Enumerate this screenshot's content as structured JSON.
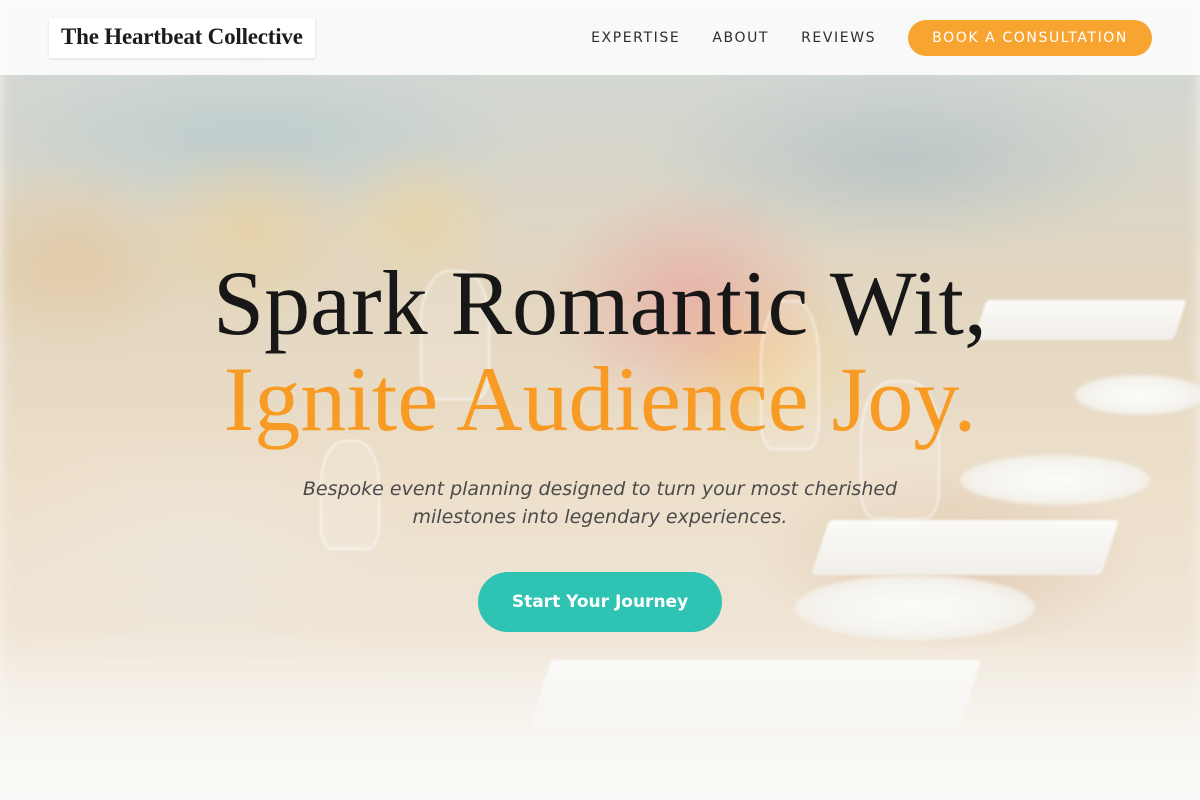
{
  "brand": {
    "name": "The Heartbeat Collective"
  },
  "nav": {
    "links": [
      "EXPERTISE",
      "ABOUT",
      "REVIEWS"
    ],
    "cta_label": "BOOK A CONSULTATION"
  },
  "hero": {
    "headline_line1": "Spark Romantic Wit,",
    "headline_line2": "Ignite Audience Joy.",
    "subtitle": "Bespoke event planning designed to turn your most cherished milestones into legendary experiences.",
    "button_label": "Start Your Journey",
    "background_image": "blurred-banquet-table-photo"
  },
  "colors": {
    "accent_orange": "#f8a431",
    "headline_orange": "#f79b24",
    "teal_button": "#2ec3b3",
    "text_dark": "#171717"
  }
}
